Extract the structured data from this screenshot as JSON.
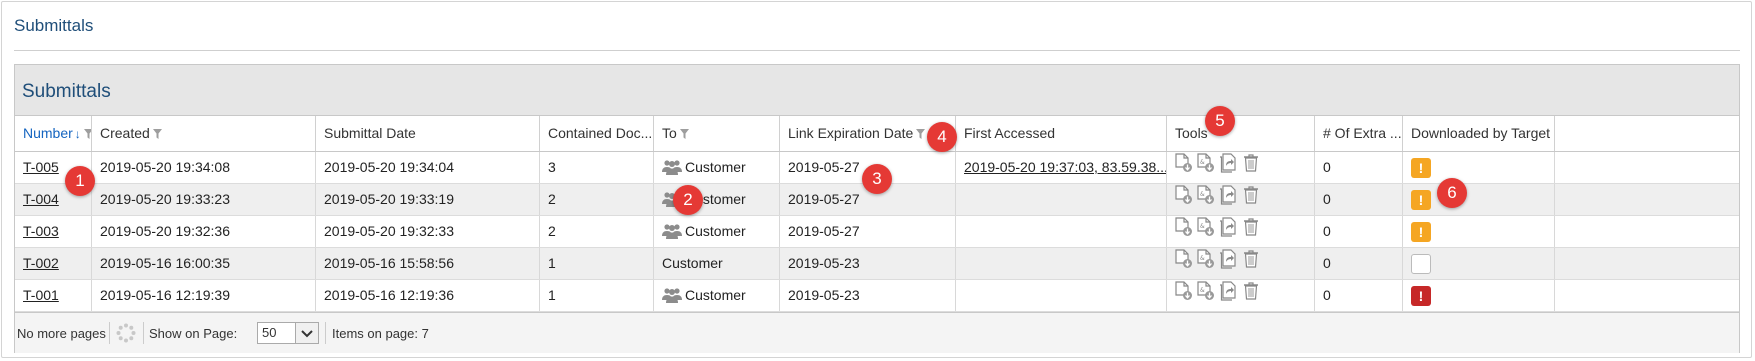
{
  "page": {
    "title": "Submittals"
  },
  "panel": {
    "title": "Submittals"
  },
  "columns": [
    "Number",
    "Created",
    "Submittal Date",
    "Contained Doc...",
    "To",
    "Link Expiration Date",
    "First Accessed",
    "Tools",
    "# Of Extra ...",
    "Downloaded by Target"
  ],
  "sort": {
    "column": "Number",
    "direction": "descending"
  },
  "rows": [
    {
      "number": "T-005",
      "created": "2019-05-20 19:34:08",
      "submittal_date": "2019-05-20 19:34:04",
      "contained": "3",
      "to": "Customer",
      "to_icon": "people-icon",
      "expiration": "2019-05-27",
      "first_accessed": "2019-05-20 19:37:03, 83.59.38...",
      "extra": "0",
      "downloaded": "warning"
    },
    {
      "number": "T-004",
      "created": "2019-05-20 19:33:23",
      "submittal_date": "2019-05-20 19:33:19",
      "contained": "2",
      "to": "Customer",
      "to_icon": "people-icon",
      "expiration": "2019-05-27",
      "first_accessed": "",
      "extra": "0",
      "downloaded": "warning"
    },
    {
      "number": "T-003",
      "created": "2019-05-20 19:32:36",
      "submittal_date": "2019-05-20 19:32:33",
      "contained": "2",
      "to": "Customer",
      "to_icon": "people-icon",
      "expiration": "2019-05-27",
      "first_accessed": "",
      "extra": "0",
      "downloaded": "warning"
    },
    {
      "number": "T-002",
      "created": "2019-05-16 16:00:35",
      "submittal_date": "2019-05-16 15:58:56",
      "contained": "1",
      "to": "Customer",
      "to_icon": "",
      "expiration": "2019-05-23",
      "first_accessed": "",
      "extra": "0",
      "downloaded": "none"
    },
    {
      "number": "T-001",
      "created": "2019-05-16 12:19:39",
      "submittal_date": "2019-05-16 12:19:36",
      "contained": "1",
      "to": "Customer",
      "to_icon": "people-icon",
      "expiration": "2019-05-23",
      "first_accessed": "",
      "extra": "0",
      "downloaded": "error"
    }
  ],
  "tools": [
    "document-download-icon",
    "certificate-download-icon",
    "forward-icon",
    "trash-icon"
  ],
  "status_symbols": {
    "warning": "!",
    "error": "!",
    "none": ""
  },
  "footer": {
    "paging": "No more pages",
    "show_on_page_label": "Show on Page:",
    "page_size": "50",
    "items_on_page": "Items on page: 7"
  },
  "markers": [
    "1",
    "2",
    "3",
    "4",
    "5",
    "6"
  ],
  "colors": {
    "title": "#1f4e79",
    "sort_accent": "#1565c0",
    "warning": "#f5a623",
    "error": "#c62828",
    "marker": "#e53935"
  }
}
